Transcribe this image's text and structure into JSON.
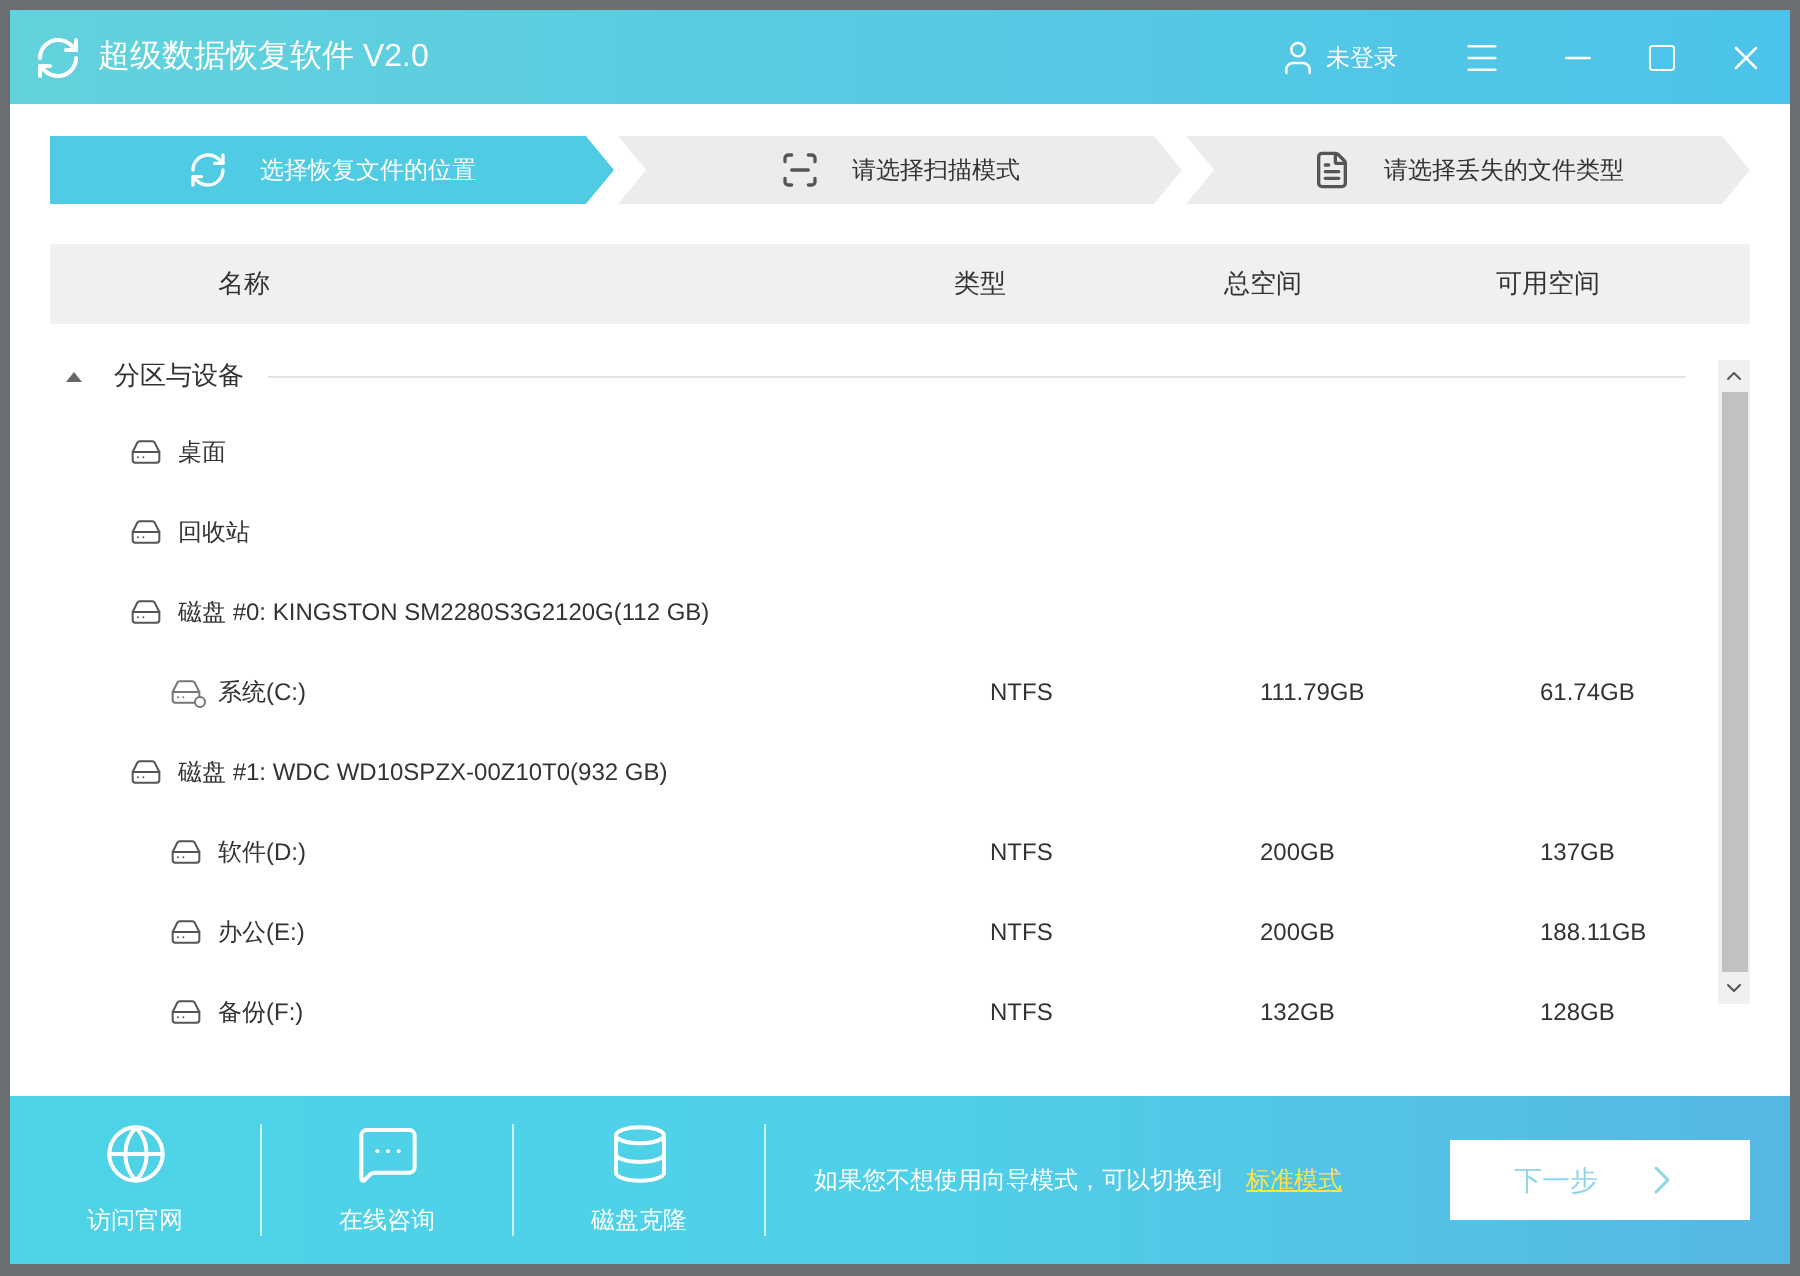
{
  "window": {
    "title": "超级数据恢复软件 V2.0",
    "user": "未登录"
  },
  "steps": [
    {
      "label": "选择恢复文件的位置",
      "selected": true,
      "kind": "location"
    },
    {
      "label": "请选择扫描模式",
      "selected": false,
      "kind": "scan"
    },
    {
      "label": "请选择丢失的文件类型",
      "selected": false,
      "kind": "file"
    }
  ],
  "table": {
    "columns": [
      "名称",
      "类型",
      "总空间",
      "可用空间"
    ]
  },
  "tree": {
    "label": "分区与设备",
    "expanded": true,
    "children": [
      {
        "name": "桌面"
      },
      {
        "name": "回收站"
      },
      {
        "name": "磁盘 #0: KINGSTON SM2280S3G2120G(112 GB)",
        "children": [
          {
            "name": "系统(C:)",
            "kind": "system",
            "type": "NTFS",
            "total": "111.79GB",
            "free": "61.74GB"
          }
        ]
      },
      {
        "name": "磁盘 #1: WDC WD10SPZX-00Z10T0(932 GB)",
        "children": [
          {
            "name": "软件(D:)",
            "type": "NTFS",
            "total": "200GB",
            "free": "137GB"
          },
          {
            "name": "办公(E:)",
            "type": "NTFS",
            "total": "200GB",
            "free": "188.11GB"
          },
          {
            "name": "备份(F:)",
            "type": "NTFS",
            "total": "132GB",
            "free": "128GB"
          }
        ]
      }
    ]
  },
  "footer": {
    "links": [
      {
        "label": "访问官网",
        "kind": "globe"
      },
      {
        "label": "在线咨询",
        "kind": "chat"
      },
      {
        "label": "磁盘克隆",
        "kind": "database"
      }
    ],
    "hint": "如果您不想使用向导模式，可以切换到",
    "switch_link": "标准模式",
    "next_button": {
      "label": "下一步",
      "disabled": true
    }
  }
}
